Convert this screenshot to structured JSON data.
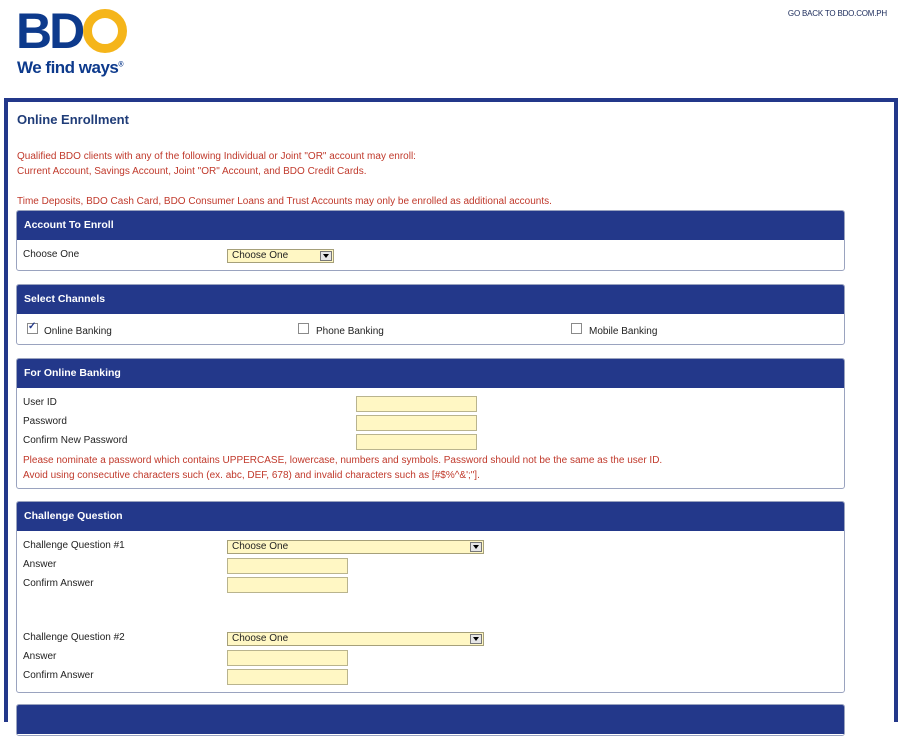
{
  "header": {
    "logo_text": "BD",
    "tagline": "We find ways",
    "tagline_mark": "®",
    "go_back_link": "GO BACK TO BDO.COM.PH"
  },
  "page": {
    "title": "Online Enrollment",
    "intro_line1": "Qualified BDO clients with any of the following Individual or Joint \"OR\" account may enroll:",
    "intro_line2": "Current Account, Savings Account, Joint \"OR\" Account, and BDO Credit Cards.",
    "intro_line3": "Time Deposits, BDO Cash Card, BDO Consumer Loans and Trust Accounts may only be enrolled as additional accounts."
  },
  "account": {
    "heading": "Account To Enroll",
    "label": "Choose One",
    "select_value": "Choose One"
  },
  "channels": {
    "heading": "Select Channels",
    "online": "Online Banking",
    "phone": "Phone Banking",
    "mobile": "Mobile Banking",
    "online_checked": true,
    "phone_checked": false,
    "mobile_checked": false
  },
  "online_banking": {
    "heading": "For Online Banking",
    "user_id_label": "User ID",
    "password_label": "Password",
    "confirm_password_label": "Confirm New Password",
    "note_line1": "Please nominate a password which contains UPPERCASE, lowercase, numbers and symbols. Password should not be the same as the user ID.",
    "note_line2": "Avoid using consecutive characters such (ex. abc, DEF, 678) and invalid characters such as [#$%^&';\"]."
  },
  "challenge": {
    "heading": "Challenge Question",
    "q1_label": "Challenge Question #1",
    "q1_value": "Choose One",
    "answer_label": "Answer",
    "confirm_answer_label": "Confirm Answer",
    "q2_label": "Challenge Question #2",
    "q2_value": "Choose One"
  },
  "colors": {
    "brand_blue": "#23388a",
    "brand_yellow": "#f5b51a",
    "note_red": "#c0392b",
    "input_fill": "#fff7c4"
  }
}
